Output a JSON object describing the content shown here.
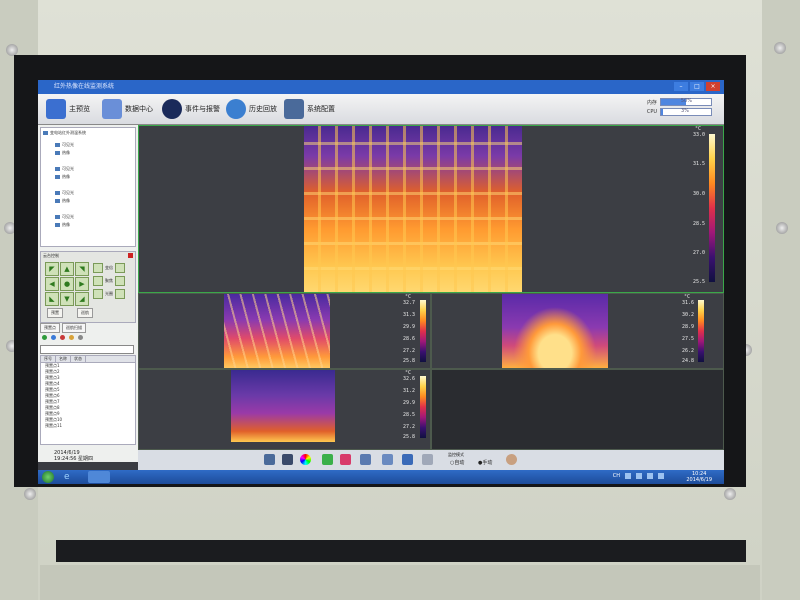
{
  "window": {
    "title": "红外热像在线监测系统"
  },
  "toolbar": {
    "items": [
      {
        "label": "主预览",
        "icon": "monitor-icon",
        "color": "#3b6fd0"
      },
      {
        "label": "数据中心",
        "icon": "database-icon",
        "color": "#6a8fd8"
      },
      {
        "label": "事件与报警",
        "icon": "alarm-icon",
        "color": "#1a2a5a"
      },
      {
        "label": "历史回放",
        "icon": "globe-icon",
        "color": "#3b7fd0"
      },
      {
        "label": "系统配置",
        "icon": "settings-icon",
        "color": "#4a6a9a"
      }
    ]
  },
  "sysmon": {
    "mem_label": "内存",
    "mem_value": "50%",
    "mem_pct": 0.5,
    "cpu_label": "CPU",
    "cpu_value": "3%",
    "cpu_pct": 0.03
  },
  "tree": {
    "root": "变电站红外测温系统",
    "nodes": [
      "可见光",
      "热像",
      "可见光",
      "热像",
      "可见光",
      "热像",
      "可见光",
      "热像"
    ]
  },
  "ptz": {
    "title": "云台控制",
    "zoom": "变倍",
    "focus": "聚焦",
    "iris": "光圈",
    "btn_preset": "预置",
    "btn_cruise": "巡航"
  },
  "tabs": [
    "预置点",
    "巡航扫描"
  ],
  "plist": {
    "headers": [
      "序号",
      "名称",
      "状态"
    ],
    "rows": [
      "预置点1",
      "预置点2",
      "预置点3",
      "预置点4",
      "预置点5",
      "预置点6",
      "预置点7",
      "预置点8",
      "预置点9",
      "预置点10",
      "预置点11"
    ]
  },
  "clock": {
    "date": "2014/6/19",
    "time": "19:24:56 星期四"
  },
  "cells": [
    {
      "unit": "°C",
      "ticks": [
        "33.0",
        "31.5",
        "30.0",
        "28.5",
        "27.0",
        "25.5"
      ]
    },
    {
      "unit": "°C",
      "ticks": [
        "32.7",
        "31.3",
        "29.9",
        "28.6",
        "27.2",
        "25.8"
      ]
    },
    {
      "unit": "°C",
      "ticks": [
        "31.6",
        "30.2",
        "28.9",
        "27.5",
        "26.2",
        "24.8"
      ]
    },
    {
      "unit": "°C",
      "ticks": [
        "32.6",
        "31.2",
        "29.9",
        "28.5",
        "27.2",
        "25.8"
      ]
    }
  ],
  "controlbar": {
    "mode_label": "监控模式",
    "auto": "自动",
    "manual": "手动"
  },
  "taskbar": {
    "lang": "CH",
    "time": "10:24",
    "date": "2014/6/19"
  }
}
